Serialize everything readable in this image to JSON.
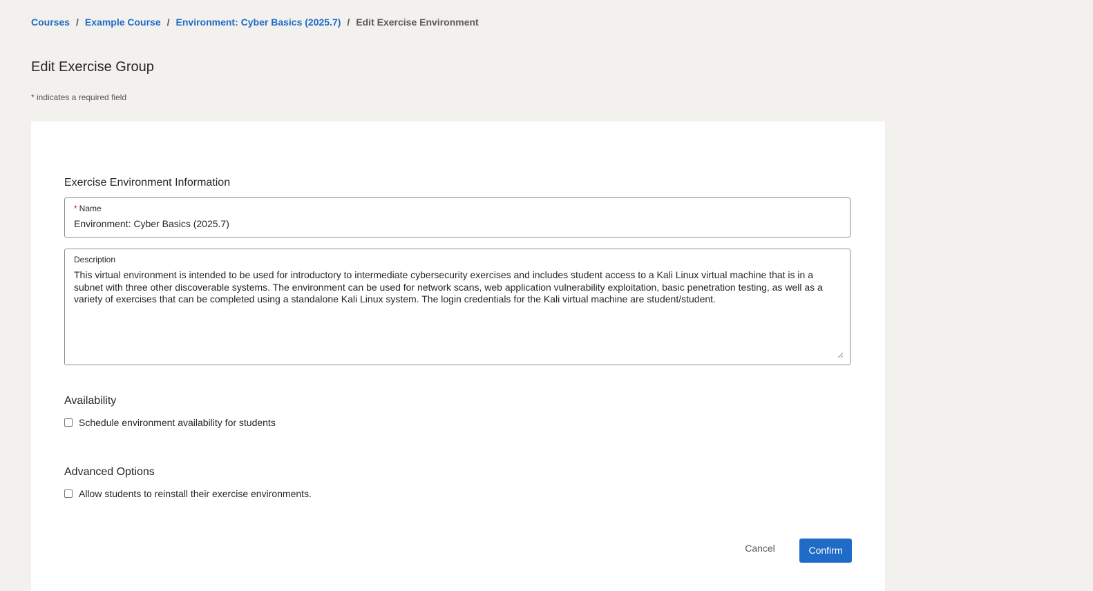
{
  "breadcrumb": {
    "items": [
      "Courses",
      "Example Course",
      "Environment: Cyber Basics (2025.7)"
    ],
    "separator": "/",
    "current": "Edit Exercise Environment"
  },
  "page": {
    "title": "Edit Exercise Group",
    "required_note": "* indicates a required field"
  },
  "form": {
    "info_heading": "Exercise Environment Information",
    "name": {
      "required_marker": "*",
      "label": "Name",
      "value": "Environment: Cyber Basics (2025.7)"
    },
    "description": {
      "label": "Description",
      "value": "This virtual environment is intended to be used for introductory to intermediate cybersecurity exercises and includes student access to a Kali Linux virtual machine that is in a subnet with three other discoverable systems. The environment can be used for network scans, web application vulnerability exploitation, basic penetration testing, as well as a variety of exercises that can be completed using a standalone Kali Linux system. The login credentials for the Kali virtual machine are student/student."
    },
    "availability": {
      "heading": "Availability",
      "checkbox_label": "Schedule environment availability for students",
      "checked": false
    },
    "advanced": {
      "heading": "Advanced Options",
      "checkbox_label": "Allow students to reinstall their exercise environments.",
      "checked": false
    },
    "actions": {
      "cancel_label": "Cancel",
      "confirm_label": "Confirm"
    }
  },
  "colors": {
    "accent": "#1f6bc7",
    "background": "#f2f1ed",
    "card": "#ffffff",
    "required": "#c42126"
  }
}
